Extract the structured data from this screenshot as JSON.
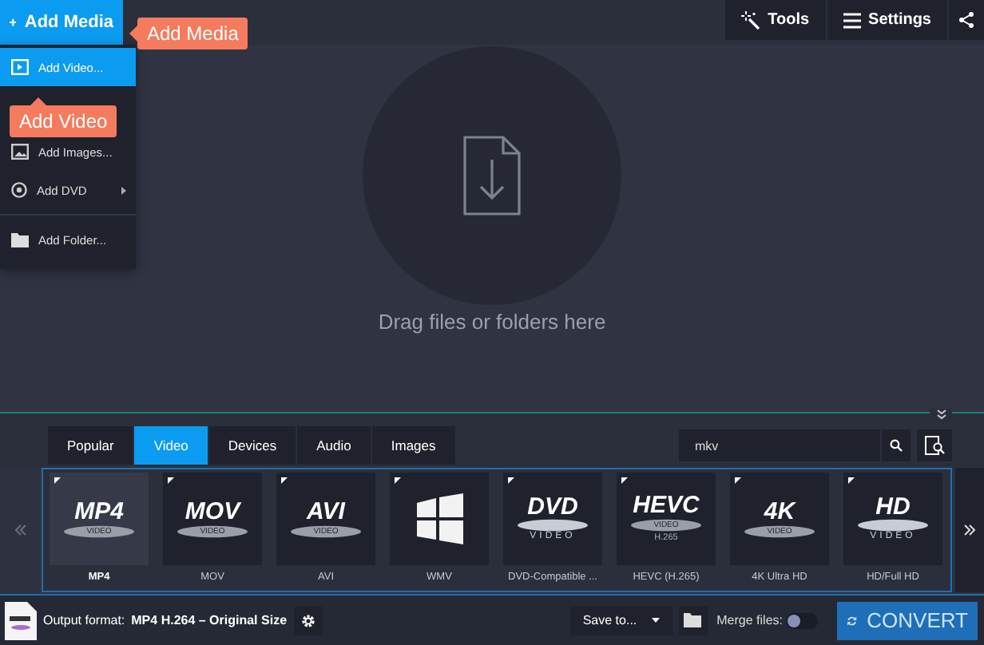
{
  "toolbar": {
    "add_media": "Add Media",
    "buttons": [
      {
        "kind": "tools",
        "label": "Tools"
      },
      {
        "kind": "settings",
        "label": "Settings"
      },
      {
        "kind": "share"
      }
    ]
  },
  "tooltips": {
    "media": "Add Media",
    "video": "Add Video"
  },
  "add_menu": {
    "items": [
      {
        "kind": "video",
        "label": "Add Video...",
        "selected": true,
        "submenu": false
      },
      {
        "kind": "images",
        "label": "Add Images...",
        "selected": false,
        "submenu": false
      },
      {
        "kind": "dvd",
        "label": "Add DVD",
        "selected": false,
        "submenu": true
      },
      {
        "kind": "folder",
        "label": "Add Folder...",
        "selected": false,
        "submenu": false
      }
    ]
  },
  "dropzone": {
    "text": "Drag files or folders here"
  },
  "format_panel": {
    "expanded": true,
    "tabs": [
      {
        "label": "Popular",
        "selected": false
      },
      {
        "label": "Video",
        "selected": true
      },
      {
        "label": "Devices",
        "selected": false
      },
      {
        "label": "Audio",
        "selected": false
      },
      {
        "label": "Images",
        "selected": false
      }
    ],
    "search": {
      "value": "mkv"
    },
    "tiles": [
      {
        "label": "MP4",
        "selected": true,
        "kind": "text",
        "logo_text": "MP4",
        "logo_sub": "VIDEO"
      },
      {
        "label": "MOV",
        "selected": false,
        "kind": "text",
        "logo_text": "MOV",
        "logo_sub": "VIDEO"
      },
      {
        "label": "AVI",
        "selected": false,
        "kind": "text",
        "logo_text": "AVI",
        "logo_sub": "VIDEO"
      },
      {
        "label": "WMV",
        "selected": false,
        "kind": "windows"
      },
      {
        "label": "DVD-Compatible ...",
        "selected": false,
        "kind": "disc",
        "logo_text": "DVD",
        "logo_sub": "VIDEO"
      },
      {
        "label": "HEVC (H.265)",
        "selected": false,
        "kind": "text",
        "logo_text": "HEVC",
        "logo_sub": "VIDEO",
        "logo_extra": "H.265"
      },
      {
        "label": "4K Ultra HD",
        "selected": false,
        "kind": "text",
        "logo_text": "4K",
        "logo_sub": "VIDEO"
      },
      {
        "label": "HD/Full HD",
        "selected": false,
        "kind": "disc",
        "logo_text": "HD",
        "logo_sub": "VIDEO"
      }
    ]
  },
  "bottom_bar": {
    "output_label": "Output format:",
    "output_value": "MP4 H.264 – Original Size",
    "save_to": "Save to...",
    "merge_label": "Merge files:",
    "merge_on": false,
    "convert": "CONVERT"
  }
}
